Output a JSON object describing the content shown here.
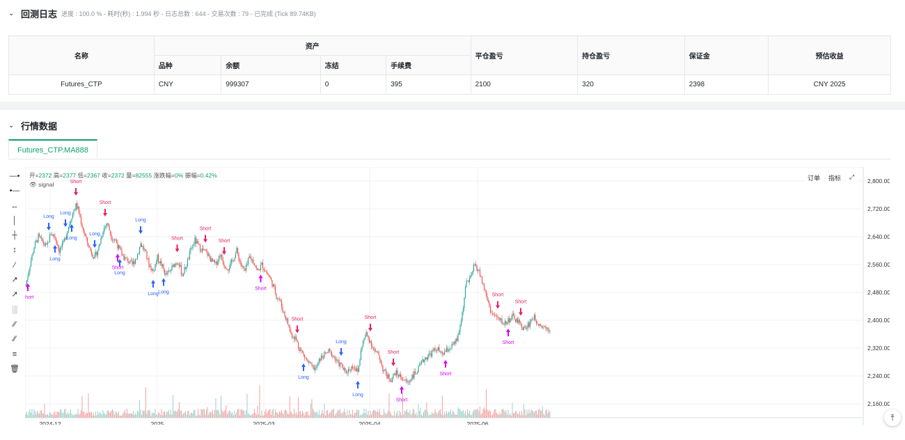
{
  "log": {
    "title": "回测日志",
    "meta": "进度 : 100.0 % - 耗时(秒) : 1.994 秒 - 日志总数 : 644 - 交易次数 : 79 - 已完成 (Tick 89.74KB)"
  },
  "assets_table": {
    "col_name": "名称",
    "col_assets": "资产",
    "col_close_pnl": "平仓盈亏",
    "col_hold_pnl": "持仓盈亏",
    "col_margin": "保证金",
    "col_est": "预估收益",
    "sub_variety": "品种",
    "sub_balance": "余额",
    "sub_frozen": "冻结",
    "sub_fee": "手续费",
    "row": {
      "name": "Futures_CTP",
      "variety": "CNY",
      "balance": "999307",
      "frozen": "0",
      "fee": "395",
      "close_pnl": "2100",
      "hold_pnl": "320",
      "margin": "2398",
      "est": "CNY 2025"
    }
  },
  "market": {
    "title": "行情数据",
    "tab": "Futures_CTP.MA888",
    "legend": {
      "open_label": "开=",
      "open": "2372",
      "high_label": "高=",
      "high": "2377",
      "low_label": "低=",
      "low": "2367",
      "close_label": "收=",
      "close": "2372",
      "vol_label": "量=",
      "vol": "82555",
      "chg_label": "涨跌幅=",
      "chg": "0%",
      "amp_label": "振幅=",
      "amp": "0.42%"
    },
    "signal_label": "signal",
    "buttons": {
      "order": "订单",
      "indicator": "指标"
    },
    "toolbar_icons": [
      "horizontal-ray-icon",
      "horizontal-line-icon",
      "extended-line-icon",
      "vertical-line-icon",
      "cross-line-icon",
      "price-range-icon",
      "trend-line-icon",
      "ray-line-icon",
      "arrow-line-icon",
      "price-label-icon",
      "parallel-channel-icon",
      "parallel-lines-icon",
      "fib-retracement-icon",
      "delete-icon"
    ]
  },
  "chart_data": {
    "type": "candlestick",
    "y_ticks": [
      "2,800.00",
      "2,720.00",
      "2,640.00",
      "2,560.00",
      "2,480.00",
      "2,400.00",
      "2,320.00",
      "2,240.00",
      "2,160.00"
    ],
    "ylim": [
      2120,
      2840
    ],
    "x_ticks": [
      "2024-12",
      "2025",
      "2025-03",
      "2025-04",
      "2025-06"
    ],
    "colors": {
      "up": "#26a69a",
      "down": "#ef5350",
      "long": "#2962ff",
      "short": "#d500f9",
      "short_close": "#e91e63"
    },
    "path": [
      [
        0,
        2500
      ],
      [
        4,
        2560
      ],
      [
        8,
        2610
      ],
      [
        12,
        2640
      ],
      [
        16,
        2625
      ],
      [
        20,
        2610
      ],
      [
        24,
        2650
      ],
      [
        28,
        2640
      ],
      [
        32,
        2600
      ],
      [
        36,
        2620
      ],
      [
        40,
        2660
      ],
      [
        44,
        2700
      ],
      [
        48,
        2730
      ],
      [
        50,
        2720
      ],
      [
        54,
        2670
      ],
      [
        58,
        2630
      ],
      [
        62,
        2600
      ],
      [
        66,
        2580
      ],
      [
        70,
        2610
      ],
      [
        74,
        2660
      ],
      [
        78,
        2680
      ],
      [
        82,
        2640
      ],
      [
        86,
        2630
      ],
      [
        90,
        2600
      ],
      [
        94,
        2580
      ],
      [
        98,
        2570
      ],
      [
        102,
        2560
      ],
      [
        106,
        2580
      ],
      [
        110,
        2620
      ],
      [
        114,
        2600
      ],
      [
        118,
        2560
      ],
      [
        122,
        2540
      ],
      [
        126,
        2580
      ],
      [
        130,
        2560
      ],
      [
        134,
        2530
      ],
      [
        138,
        2540
      ],
      [
        142,
        2560
      ],
      [
        146,
        2570
      ],
      [
        150,
        2530
      ],
      [
        154,
        2560
      ],
      [
        158,
        2600
      ],
      [
        162,
        2630
      ],
      [
        166,
        2610
      ],
      [
        170,
        2600
      ],
      [
        174,
        2590
      ],
      [
        178,
        2570
      ],
      [
        182,
        2560
      ],
      [
        186,
        2590
      ],
      [
        190,
        2560
      ],
      [
        194,
        2550
      ],
      [
        198,
        2570
      ],
      [
        202,
        2600
      ],
      [
        206,
        2560
      ],
      [
        210,
        2540
      ],
      [
        214,
        2580
      ],
      [
        218,
        2570
      ],
      [
        222,
        2540
      ],
      [
        226,
        2560
      ],
      [
        230,
        2540
      ],
      [
        234,
        2520
      ],
      [
        238,
        2490
      ],
      [
        240,
        2470
      ],
      [
        243,
        2460
      ],
      [
        246,
        2430
      ],
      [
        250,
        2400
      ],
      [
        254,
        2360
      ],
      [
        258,
        2350
      ],
      [
        262,
        2320
      ],
      [
        266,
        2300
      ],
      [
        270,
        2280
      ],
      [
        274,
        2265
      ],
      [
        278,
        2260
      ],
      [
        282,
        2290
      ],
      [
        286,
        2300
      ],
      [
        290,
        2310
      ],
      [
        294,
        2300
      ],
      [
        298,
        2280
      ],
      [
        302,
        2270
      ],
      [
        306,
        2250
      ],
      [
        310,
        2260
      ],
      [
        314,
        2270
      ],
      [
        318,
        2250
      ],
      [
        322,
        2330
      ],
      [
        326,
        2360
      ],
      [
        330,
        2340
      ],
      [
        334,
        2310
      ],
      [
        338,
        2300
      ],
      [
        342,
        2260
      ],
      [
        346,
        2240
      ],
      [
        350,
        2230
      ],
      [
        354,
        2250
      ],
      [
        358,
        2240
      ],
      [
        362,
        2230
      ],
      [
        366,
        2220
      ],
      [
        370,
        2240
      ],
      [
        374,
        2250
      ],
      [
        378,
        2270
      ],
      [
        382,
        2290
      ],
      [
        386,
        2300
      ],
      [
        390,
        2310
      ],
      [
        394,
        2320
      ],
      [
        398,
        2300
      ],
      [
        402,
        2310
      ],
      [
        406,
        2320
      ],
      [
        410,
        2330
      ],
      [
        414,
        2350
      ],
      [
        418,
        2420
      ],
      [
        422,
        2510
      ],
      [
        426,
        2520
      ],
      [
        430,
        2560
      ],
      [
        434,
        2540
      ],
      [
        438,
        2500
      ],
      [
        442,
        2460
      ],
      [
        446,
        2420
      ],
      [
        450,
        2410
      ],
      [
        454,
        2400
      ],
      [
        458,
        2390
      ],
      [
        462,
        2400
      ],
      [
        466,
        2410
      ],
      [
        470,
        2400
      ],
      [
        474,
        2385
      ],
      [
        478,
        2375
      ],
      [
        482,
        2390
      ],
      [
        486,
        2410
      ],
      [
        490,
        2395
      ],
      [
        494,
        2385
      ],
      [
        498,
        2380
      ],
      [
        502,
        2375
      ]
    ],
    "signals": [
      {
        "i": 2,
        "label": "Short",
        "dir": "short",
        "pos": "below"
      },
      {
        "i": 22,
        "label": "Long",
        "dir": "long",
        "pos": "above"
      },
      {
        "i": 38,
        "label": "Long",
        "dir": "long",
        "pos": "above"
      },
      {
        "i": 48,
        "label": "Short",
        "dir": "short_close",
        "pos": "above"
      },
      {
        "i": 66,
        "label": "Long",
        "dir": "long",
        "pos": "above"
      },
      {
        "i": 76,
        "label": "Short",
        "dir": "short_close",
        "pos": "above"
      },
      {
        "i": 110,
        "label": "Long",
        "dir": "long",
        "pos": "above"
      },
      {
        "i": 145,
        "label": "Short",
        "dir": "short_close",
        "pos": "above"
      },
      {
        "i": 172,
        "label": "Short",
        "dir": "short_close",
        "pos": "above"
      },
      {
        "i": 190,
        "label": "Short",
        "dir": "short_close",
        "pos": "above"
      },
      {
        "i": 28,
        "label": "Long",
        "dir": "long",
        "pos": "below"
      },
      {
        "i": 44,
        "label": "Long",
        "dir": "long",
        "pos": "below"
      },
      {
        "i": 90,
        "label": "Long",
        "dir": "long",
        "pos": "below"
      },
      {
        "i": 122,
        "label": "Long",
        "dir": "long",
        "pos": "below"
      },
      {
        "i": 132,
        "label": "Long",
        "dir": "long",
        "pos": "below"
      },
      {
        "i": 88,
        "label": "Short",
        "dir": "short",
        "pos": "below"
      },
      {
        "i": 225,
        "label": "Short",
        "dir": "short",
        "pos": "below"
      },
      {
        "i": 260,
        "label": "Short",
        "dir": "short_close",
        "pos": "above"
      },
      {
        "i": 302,
        "label": "Long",
        "dir": "long",
        "pos": "above"
      },
      {
        "i": 330,
        "label": "Short",
        "dir": "short_close",
        "pos": "above"
      },
      {
        "i": 352,
        "label": "Short",
        "dir": "short_close",
        "pos": "above"
      },
      {
        "i": 266,
        "label": "Long",
        "dir": "long",
        "pos": "below"
      },
      {
        "i": 318,
        "label": "Long",
        "dir": "long",
        "pos": "below"
      },
      {
        "i": 360,
        "label": "Short",
        "dir": "short",
        "pos": "below"
      },
      {
        "i": 402,
        "label": "Short",
        "dir": "short",
        "pos": "below"
      },
      {
        "i": 452,
        "label": "Short",
        "dir": "short_close",
        "pos": "above"
      },
      {
        "i": 474,
        "label": "Short",
        "dir": "short_close",
        "pos": "above"
      },
      {
        "i": 462,
        "label": "Short",
        "dir": "short",
        "pos": "below"
      }
    ]
  }
}
